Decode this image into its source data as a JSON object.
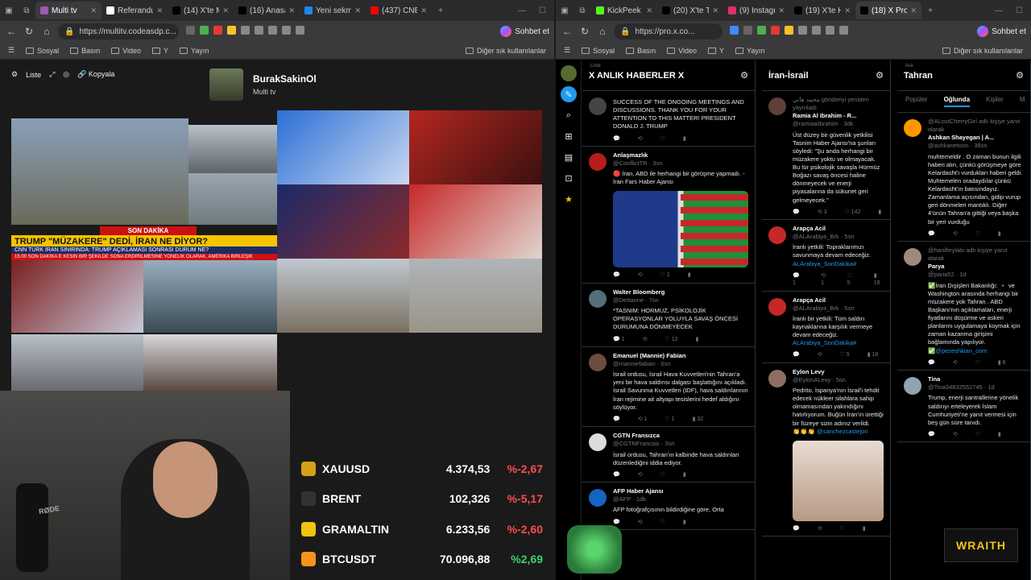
{
  "left_window": {
    "tabs": [
      {
        "label": "Multi tv",
        "active": true,
        "color": "#9b59b6"
      },
      {
        "label": "Referandum",
        "color": "#ffffff"
      },
      {
        "label": "(14) X'te Ma",
        "color": "#000000"
      },
      {
        "label": "(16) Anasayf",
        "color": "#000000"
      },
      {
        "label": "Yeni sekme",
        "color": "#1e88e5"
      },
      {
        "label": "(437) CNBC",
        "color": "#ff0000"
      }
    ],
    "url": "https://multitv.codeasdp.c...",
    "copilot_label": "Sohbet et",
    "bookmarks": [
      "Sosyal",
      "Basın",
      "Video",
      "Y",
      "Yayın"
    ],
    "bookmarks_more": "Diğer sık kullanılanlar",
    "toolbar": {
      "list": "Liste",
      "copy": "Kopyala"
    },
    "channel": {
      "name": "BurakSakinOl",
      "subtitle": "Multi tv"
    },
    "lower_third": {
      "top": "SON DAKİKA",
      "headline": "TRUMP \"MÜZAKERE\" DEDİ, İRAN NE DİYOR?",
      "sub": "CNN TÜRK İRAN SINIRINDA: TRUMP AÇIKLAMASI SONRASI DURUM NE?",
      "ticker": "15:00 SON DAKİKA  E KESİN BİR ŞEKİLDE SONA ERDİRİLMESİNE YÖNELİK OLARAK, AMERİKA BİRLEŞİK"
    },
    "ticker_rows": [
      {
        "symbol": "XAUUSD",
        "value": "4.374,53",
        "change": "%-2,67",
        "dir": "neg",
        "icon_color": "#d4a017"
      },
      {
        "symbol": "BRENT",
        "value": "102,326",
        "change": "%-5,17",
        "dir": "neg",
        "icon_color": "#333333"
      },
      {
        "symbol": "GRAMALTIN",
        "value": "6.233,56",
        "change": "%-2,60",
        "dir": "neg",
        "icon_color": "#f1c40f"
      },
      {
        "symbol": "BTCUSDT",
        "value": "70.096,88",
        "change": "%2,69",
        "dir": "pos",
        "icon_color": "#f7931a"
      }
    ]
  },
  "right_window": {
    "tabs": [
      {
        "label": "KickPeek",
        "color": "#53fc18"
      },
      {
        "label": "(20) X'te T2",
        "color": "#000000"
      },
      {
        "label": "(9) Instagram",
        "color": "#e1306c"
      },
      {
        "label": "(19) X'te Ha",
        "color": "#000000"
      },
      {
        "label": "(18) X Pro",
        "active": true,
        "color": "#000000"
      }
    ],
    "url": "https://pro.x.co...",
    "copilot_label": "Sohbet et",
    "bookmarks": [
      "Sosyal",
      "Basın",
      "Video",
      "Y",
      "Yayın"
    ],
    "bookmarks_more": "Diğer sık kullanılanlar",
    "columns": [
      {
        "small": "Liste",
        "title": "X ANLIK HABERLER X",
        "tweets": [
          {
            "name": "",
            "handle": "",
            "text": "SUCCESS OF THE ONGOING MEETINGS AND DISCUSSIONS. THANK YOU FOR YOUR ATTENTION TO THIS MATTER! PRESIDENT DONALD J. TRUMP",
            "stats": [
              "",
              "",
              "",
              ""
            ],
            "avatar": "#444444"
          },
          {
            "name": "Anlaşmazlık",
            "handle": "@ConflictTR · 3sn",
            "text": "🔴 İran, ABD ile herhangi bir görüşme yapmadı. - İran Fars Haber Ajansı",
            "stats": [
              "",
              "",
              "1",
              ""
            ],
            "avatar": "#b71c1c",
            "flag": true
          },
          {
            "name": "Walter Bloomberg",
            "handle": "@DeItaone · 7sn",
            "text": "*TASNIM: HORMUZ, PSİKOLOJİK OPERASYONLAR YOLUYLA SAVAŞ ÖNCESİ DURUMUNA DÖNMEYECEK",
            "stats": [
              "1",
              "",
              "12",
              ""
            ],
            "avatar": "#546e7a"
          },
          {
            "name": "Emanuel (Mannie) Fabian",
            "handle": "@manniefabian · 6sn",
            "text": "İsrail ordusu, İsrail Hava Kuvvetleri'nin Tahran'a yeni bir hava saldırısı dalgası başlattığını açıkladı. İsrail Savunma Kuvvetleri (IDF), hava saldırılarının İran rejimine ait altyapı tesislerini hedef aldığını söylüyor.",
            "stats": [
              "",
              "1",
              "1",
              "32"
            ],
            "avatar": "#6d4c41"
          },
          {
            "name": "CGTN Fransızca",
            "handle": "@CGTNFrancais · 3sn",
            "text": "İsrail ordusu, Tahran'ın kalbinde hava saldırıları düzenlediğini iddia ediyor.",
            "stats": [
              "",
              "",
              "",
              ""
            ],
            "avatar": "#dddddd"
          },
          {
            "name": "AFP Haber Ajansı",
            "handle": "@AFP · 1dk",
            "text": "AFP fotoğrafçısının bildirdiğine göre, Orta",
            "stats": [
              "",
              "",
              "",
              ""
            ],
            "avatar": "#1565c0"
          }
        ]
      },
      {
        "small": "",
        "title": "İran-İsrail",
        "tweets": [
          {
            "name": "Ramia Al Ibrahim - R...",
            "handle": "@ramiaalibrahim · 3dk",
            "pre": "محمد هاني gönderiyi yeniden yayınladı",
            "text": "Üst düzey bir güvenlik yetkilisi Tasnim Haber Ajansı'na şunları söyledi: \"Şu anda herhangi bir müzakere yoktu ve olmayacak. Bu tür psikolojik savaşla Hürmüz Boğazı savaş öncesi haline dönmeyecek ve enerji piyasalarına da sükunet geri gelmeyecek.\"",
            "stats": [
              "",
              "3",
              "142",
              ""
            ],
            "avatar": "#5d4037"
          },
          {
            "name": "Arapça Acil",
            "handle": "@ALArabiya_Brk · 5sn",
            "text": "İranlı yetkili: Topraklarımızı savunmaya devam edeceğiz.",
            "link": "ALArabiya_SonDakika#",
            "stats": [
              "1",
              "1",
              "5",
              "18"
            ],
            "avatar": "#c62828"
          },
          {
            "name": "Arapça Acil",
            "handle": "@ALArabiya_Brk · 5sn",
            "text": "İranlı bir yetkili: Tüm saldırı kaynaklarına karşılık vermeye devam edeceğiz.",
            "link": "ALArabiya_SonDakika#",
            "stats": [
              "",
              "",
              "5",
              "18"
            ],
            "avatar": "#c62828"
          },
          {
            "name": "Eylon Levy",
            "handle": "@EylonALevy · 5sn",
            "text": "Pedrito, İspanya'nın İsrail'i tehdit edecek nükleer silahlara sahip olmamasından yakındığını hatırlıyorum. Buğün İran'ın ürettiği bir füzeye sizin adınız verildi.",
            "link": "👏👏👏 @sanchezcastejon",
            "stats": [
              "",
              "",
              "",
              ""
            ],
            "avatar": "#8d6e63",
            "video": true
          }
        ]
      },
      {
        "small": "Ara",
        "title": "Tahran",
        "tabs": [
          "Popüler",
          "Oğlunda",
          "Kişiler",
          "M"
        ],
        "tweets": [
          {
            "name": "Ashkan Shayegan | A...",
            "handle": "@ashkanetoon · 38sn",
            "pre": "@ALostCherryGirl adlı kişiye yanıt olarak",
            "text": "muhtemeldir . O zaman bunun ilgili haberi alın, çünkü görüşmeye göre Kelardasht'ı vurdukları haberi geldi. Muhtemelen oradaydılar çünkü Kelardasht'ın batısındayız. Zamanlama açısından, gidip vurup geri dönmeleri mantıklı. Diğer 4'ünün Tahran'a gittiği veya başka bir yeri vurduğu",
            "stats": [
              "",
              "",
              "",
              ""
            ],
            "avatar": "#ff9800"
          },
          {
            "name": "Parya",
            "handle": "@paria52 · 1d",
            "pre": "@hanifleylabi adlı kişiye yanıt olarak",
            "text": "✅İran Dışişleri Bakanlığı: 🔹 ve Washington arasında herhangi bir müzakere yok Tahran . ABD Başkanı'nın açıklamaları, enerji fiyatlarını düşürme ve askeri planlarını uygulamaya koymak için zaman kazanma girişimi bağlamında yapılıyor.",
            "link": "✅@pezeshkian_com",
            "stats": [
              "",
              "",
              "",
              "8"
            ],
            "avatar": "#a1887f"
          },
          {
            "name": "Tina",
            "handle": "@Tina34832552745 · 1d",
            "text": "Trump, enerji santrallerine yönelik saldırıyı erteleyerek İslam Cumhuriyeti'ne yanıt vermesi için beş gün süre tanıdı.",
            "stats": [
              "",
              "",
              "",
              ""
            ],
            "avatar": "#90a4ae"
          }
        ]
      }
    ]
  },
  "overlay": {
    "brand": "WRAITH"
  }
}
